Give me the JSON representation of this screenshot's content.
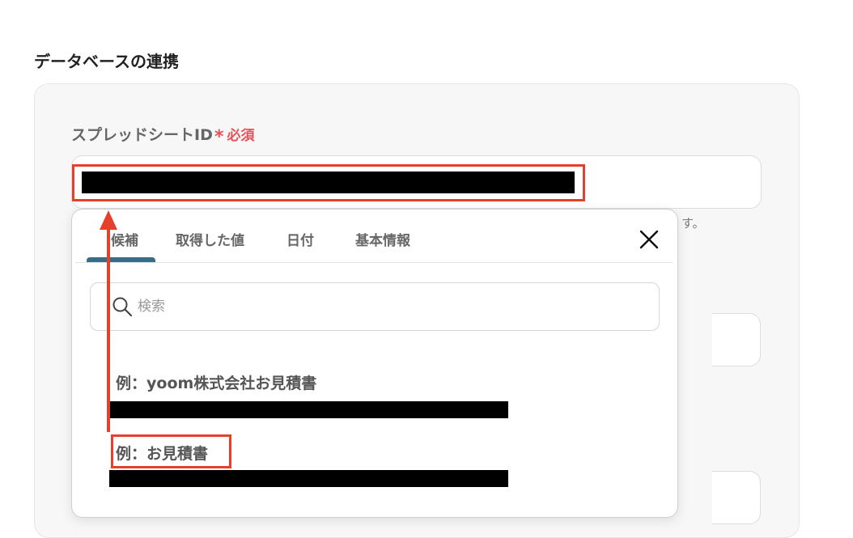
{
  "section": {
    "title": "データベースの連携"
  },
  "field": {
    "label": "スプレッドシートID",
    "required_mark": "*",
    "required_label": "必須",
    "help_tail": "す。"
  },
  "popup": {
    "tabs": [
      {
        "label": "候補",
        "active": true
      },
      {
        "label": "取得した値",
        "active": false
      },
      {
        "label": "日付",
        "active": false
      },
      {
        "label": "基本情報",
        "active": false
      }
    ],
    "search_placeholder": "検索",
    "options": [
      {
        "title": "例：yoom株式会社お見積書"
      },
      {
        "title": "例：お見積書"
      }
    ]
  },
  "colors": {
    "highlight": "#e4402b",
    "required": "#e4525a",
    "tab_active": "#3a6c86"
  }
}
